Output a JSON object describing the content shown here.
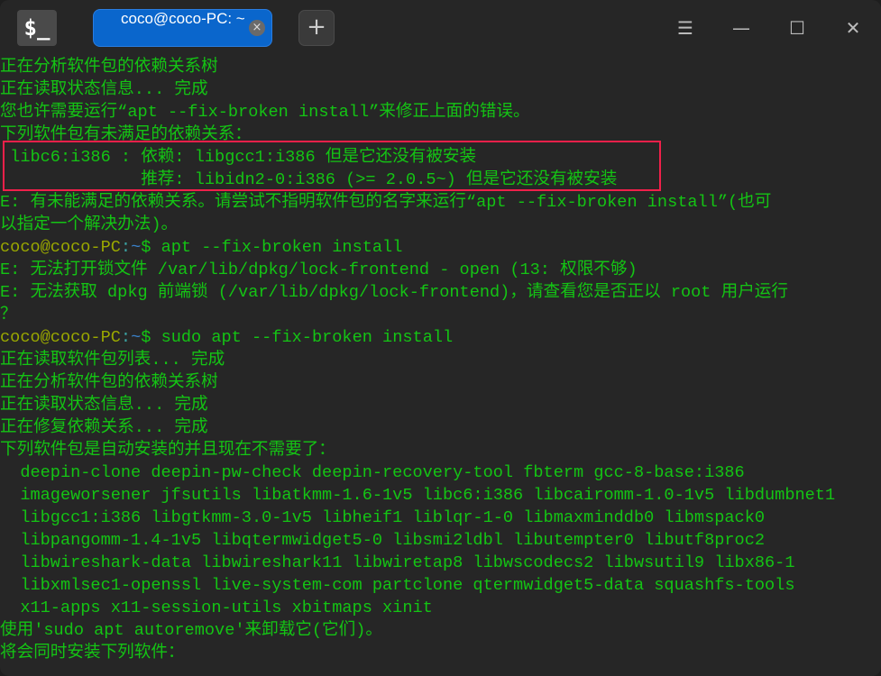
{
  "titlebar": {
    "app_icon": "$_",
    "tab_label": "coco@coco-PC: ~",
    "tab_close": "×",
    "add_tab": "+",
    "menu_icon": "☰",
    "minimize_icon": "—",
    "maximize_icon": "☐",
    "close_icon": "✕"
  },
  "colors": {
    "text": "#14c414",
    "user": "#9aa800",
    "path": "#3a80c8",
    "tab": "#0a66cc",
    "highlight": "#f0204a"
  },
  "terminal": {
    "lines": [
      [
        {
          "t": "正在分析软件包的依赖关系树",
          "c": "text"
        }
      ],
      [
        {
          "t": "正在读取状态信息... 完成",
          "c": "text"
        }
      ],
      [
        {
          "t": "您也许需要运行“apt --fix-broken install”来修正上面的错误。",
          "c": "text"
        }
      ],
      [
        {
          "t": "下列软件包有未满足的依赖关系：",
          "c": "text"
        }
      ],
      [
        {
          "t": " libc6:i386 : 依赖: libgcc1:i386 但是它还没有被安装",
          "c": "text"
        }
      ],
      [
        {
          "t": "              推荐: libidn2-0:i386 (>= 2.0.5~) 但是它还没有被安装",
          "c": "text"
        }
      ],
      [
        {
          "t": "E: 有未能满足的依赖关系。请尝试不指明软件包的名字来运行“apt --fix-broken install”(也可",
          "c": "text"
        }
      ],
      [
        {
          "t": "以指定一个解决办法)。",
          "c": "text"
        }
      ],
      [
        {
          "t": "coco@coco-PC",
          "c": "user"
        },
        {
          "t": ":",
          "c": "colon"
        },
        {
          "t": "~",
          "c": "path"
        },
        {
          "t": "$ ",
          "c": "dollar"
        },
        {
          "t": "apt --fix-broken install",
          "c": "text"
        }
      ],
      [
        {
          "t": "E: 无法打开锁文件 /var/lib/dpkg/lock-frontend - open (13: 权限不够)",
          "c": "text"
        }
      ],
      [
        {
          "t": "E: 无法获取 dpkg 前端锁 (/var/lib/dpkg/lock-frontend)，请查看您是否正以 root 用户运行",
          "c": "text"
        }
      ],
      [
        {
          "t": "？",
          "c": "text"
        }
      ],
      [
        {
          "t": "coco@coco-PC",
          "c": "user"
        },
        {
          "t": ":",
          "c": "colon"
        },
        {
          "t": "~",
          "c": "path"
        },
        {
          "t": "$ ",
          "c": "dollar"
        },
        {
          "t": "sudo apt --fix-broken install",
          "c": "text"
        }
      ],
      [
        {
          "t": "正在读取软件包列表... 完成",
          "c": "text"
        }
      ],
      [
        {
          "t": "正在分析软件包的依赖关系树",
          "c": "text"
        }
      ],
      [
        {
          "t": "正在读取状态信息... 完成",
          "c": "text"
        }
      ],
      [
        {
          "t": "正在修复依赖关系... 完成",
          "c": "text"
        }
      ],
      [
        {
          "t": "下列软件包是自动安装的并且现在不需要了：",
          "c": "text"
        }
      ],
      [
        {
          "t": "  deepin-clone deepin-pw-check deepin-recovery-tool fbterm gcc-8-base:i386",
          "c": "text"
        }
      ],
      [
        {
          "t": "  imageworsener jfsutils libatkmm-1.6-1v5 libc6:i386 libcairomm-1.0-1v5 libdumbnet1",
          "c": "text"
        }
      ],
      [
        {
          "t": "  libgcc1:i386 libgtkmm-3.0-1v5 libheif1 liblqr-1-0 libmaxminddb0 libmspack0",
          "c": "text"
        }
      ],
      [
        {
          "t": "  libpangomm-1.4-1v5 libqtermwidget5-0 libsmi2ldbl libutempter0 libutf8proc2",
          "c": "text"
        }
      ],
      [
        {
          "t": "  libwireshark-data libwireshark11 libwiretap8 libwscodecs2 libwsutil9 libx86-1",
          "c": "text"
        }
      ],
      [
        {
          "t": "  libxmlsec1-openssl live-system-com partclone qtermwidget5-data squashfs-tools",
          "c": "text"
        }
      ],
      [
        {
          "t": "  x11-apps x11-session-utils xbitmaps xinit",
          "c": "text"
        }
      ],
      [
        {
          "t": "使用'sudo apt autoremove'来卸载它(它们)。",
          "c": "text"
        }
      ],
      [
        {
          "t": "将会同时安装下列软件：",
          "c": "text"
        }
      ]
    ]
  }
}
